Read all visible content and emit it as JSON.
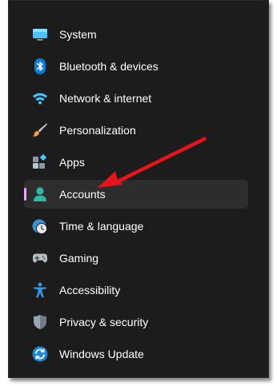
{
  "sidebar": {
    "items": [
      {
        "label": "System",
        "icon": "monitor-icon"
      },
      {
        "label": "Bluetooth & devices",
        "icon": "bluetooth-icon"
      },
      {
        "label": "Network & internet",
        "icon": "wifi-icon"
      },
      {
        "label": "Personalization",
        "icon": "paintbrush-icon"
      },
      {
        "label": "Apps",
        "icon": "apps-icon"
      },
      {
        "label": "Accounts",
        "icon": "person-icon",
        "selected": true
      },
      {
        "label": "Time & language",
        "icon": "clock-globe-icon"
      },
      {
        "label": "Gaming",
        "icon": "gamepad-icon"
      },
      {
        "label": "Accessibility",
        "icon": "accessibility-icon"
      },
      {
        "label": "Privacy & security",
        "icon": "shield-icon"
      },
      {
        "label": "Windows Update",
        "icon": "update-icon"
      }
    ]
  },
  "colors": {
    "background": "#1c1c1c",
    "selected_background": "#2d2d2d",
    "selection_indicator": "#e6a9f5",
    "annotation_arrow": "#e8141b"
  }
}
